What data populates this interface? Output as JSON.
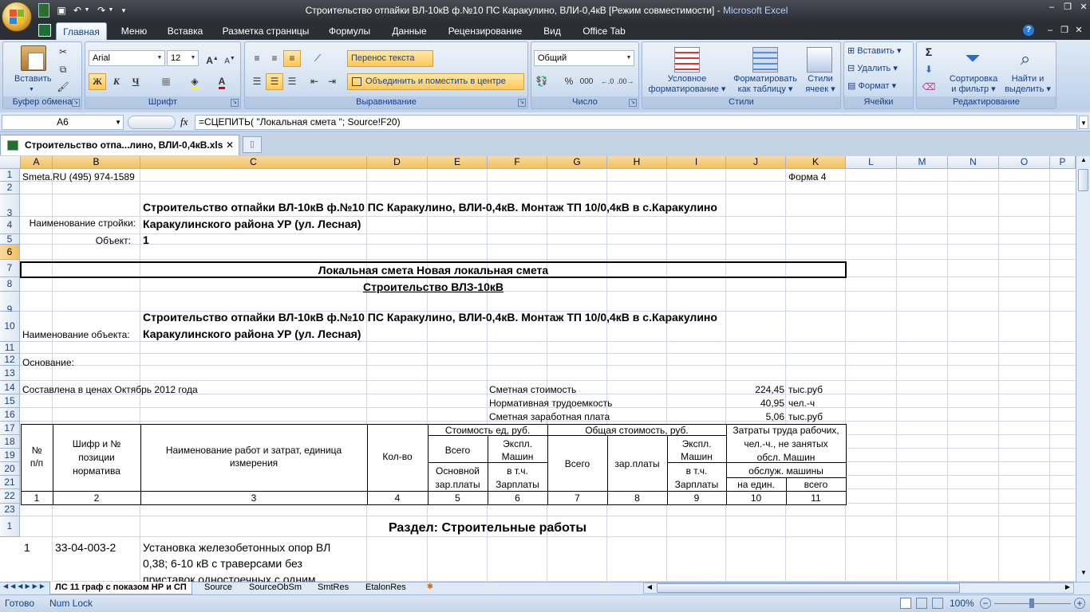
{
  "window": {
    "title": "Строительство отпайки ВЛ-10кВ ф.№10 ПС Каракулино, ВЛИ-0,4кВ  [Режим совместимости]",
    "app_name": "Microsoft Excel",
    "separator": " - "
  },
  "ribbon_tabs": [
    "Главная",
    "Меню",
    "Вставка",
    "Разметка страницы",
    "Формулы",
    "Данные",
    "Рецензирование",
    "Вид",
    "Office Tab"
  ],
  "ribbon": {
    "clipboard": {
      "label": "Буфер обмена",
      "paste": "Вставить"
    },
    "font": {
      "label": "Шрифт",
      "font_name": "Arial",
      "font_size": "12",
      "bold": "Ж",
      "italic": "К",
      "underline": "Ч"
    },
    "alignment": {
      "label": "Выравнивание",
      "wrap_text": "Перенос текста",
      "merge_center": "Объединить и поместить в центре"
    },
    "number": {
      "label": "Число",
      "format": "Общий",
      "percent": "%",
      "thousands": "000"
    },
    "styles": {
      "label": "Стили",
      "conditional_l1": "Условное",
      "conditional_l2": "форматирование",
      "format_table_l1": "Форматировать",
      "format_table_l2": "как таблицу",
      "cell_styles_l1": "Стили",
      "cell_styles_l2": "ячеек"
    },
    "cells": {
      "label": "Ячейки",
      "insert": "Вставить",
      "delete": "Удалить",
      "format": "Формат"
    },
    "editing": {
      "label": "Редактирование",
      "sum": "Σ",
      "sort_l1": "Сортировка",
      "sort_l2": "и фильтр",
      "find_l1": "Найти и",
      "find_l2": "выделить"
    }
  },
  "formula_bar": {
    "name_box": "A6",
    "fx": "fx",
    "formula": "=СЦЕПИТЬ( \"Локальная смета \"; Source!F20)"
  },
  "document_tab": {
    "name": "Строительство отпа...лино, ВЛИ-0,4кВ.xls",
    "close": "✕"
  },
  "columns": [
    "A",
    "B",
    "C",
    "D",
    "E",
    "F",
    "G",
    "H",
    "I",
    "J",
    "K",
    "L",
    "M",
    "N",
    "O",
    "P"
  ],
  "rows": [
    "1",
    "2",
    "3",
    "4",
    "5",
    "6",
    "7",
    "8",
    "9",
    "10",
    "11",
    "12",
    "13",
    "14",
    "15",
    "16",
    "17",
    "18",
    "19",
    "20",
    "21",
    "22",
    "23",
    "1"
  ],
  "cells": {
    "a1": "Smeta.RU  (495) 974-1589",
    "k1": "Форма 4",
    "a3": "Наименование стройки:",
    "c3_1": "Строительство отпайки ВЛ-10кВ ф.№10 ПС Каракулино, ВЛИ-0,4кВ. Монтаж ТП 10/0,4кВ в с.Каракулино",
    "c3_2": "Каракулинского района УР (ул. Лесная)",
    "b4": "Объект:",
    "c4": "1",
    "title6": "Локальная смета Новая локальная смета",
    "title7": "Строительство ВЛЗ-10кВ",
    "a9": "Наименование объекта:",
    "c9_1": "Строительство отпайки ВЛ-10кВ ф.№10 ПС Каракулино, ВЛИ-0,4кВ. Монтаж ТП 10/0,4кВ в с.Каракулино",
    "c9_2": "Каракулинского района УР (ул. Лесная)",
    "a11": "Основание:",
    "a13": "Составлена в ценах Октябрь 2012 года",
    "f13": "Сметная стоимость",
    "j13": "224,45",
    "k13": "тыс.руб",
    "f14": "Нормативная трудоемкость",
    "j14": "40,95",
    "k14": "чел.-ч",
    "f15": "Сметная заработная плата",
    "j15": "5,06",
    "k15": "тыс.руб"
  },
  "table_header": {
    "npp_1": "№",
    "npp_2": "п/п",
    "code_1": "Шифр и №",
    "code_2": "позиции",
    "code_3": "норматива",
    "name_1": "Наименование работ и затрат, единица",
    "name_2": "измерения",
    "qty": "Кол-во",
    "unit_cost": "Стоимость ед, руб.",
    "total_cost": "Общая стоимость, руб.",
    "labor_1": "Затраты труда рабочих,",
    "labor_2": "чел.-ч., не занятых",
    "labor_3": "обсл. Машин",
    "all": "Всего",
    "expl_1": "Экспл.",
    "expl_2": "Машин",
    "basic_1": "Основной",
    "basic_2": "зар.платы",
    "incl_1": "в т.ч.",
    "incl_2": "Зарплаты",
    "all2": "Всего",
    "wage": "зар.платы",
    "expl2_1": "Экспл.",
    "expl2_2": "Машин",
    "incl2_1": "в т.ч.",
    "incl2_2": "Зарплаты",
    "serv": "обслуж. машины",
    "per_unit": "на един.",
    "total": "всего"
  },
  "col_numbers": [
    "1",
    "2",
    "3",
    "4",
    "5",
    "6",
    "7",
    "8",
    "9",
    "10",
    "11"
  ],
  "section": "Раздел: Строительные работы",
  "item1": {
    "num": "1",
    "code": "33-04-003-2",
    "name_1": "Установка железобетонных опор ВЛ",
    "name_2": "0,38; 6-10 кВ с траверсами без",
    "name_3": "приставок одностоечных с одним"
  },
  "sheet_tabs": [
    "ЛС 11 граф с показом НР и СП",
    "Source",
    "SourceObSm",
    "SmtRes",
    "EtalonRes"
  ],
  "status": {
    "ready": "Готово",
    "numlock": "Num Lock",
    "zoom": "100%"
  },
  "colors": {
    "accent": "#15428b",
    "selection": "#f1c15f",
    "ribbon": "#c6d8ee"
  }
}
